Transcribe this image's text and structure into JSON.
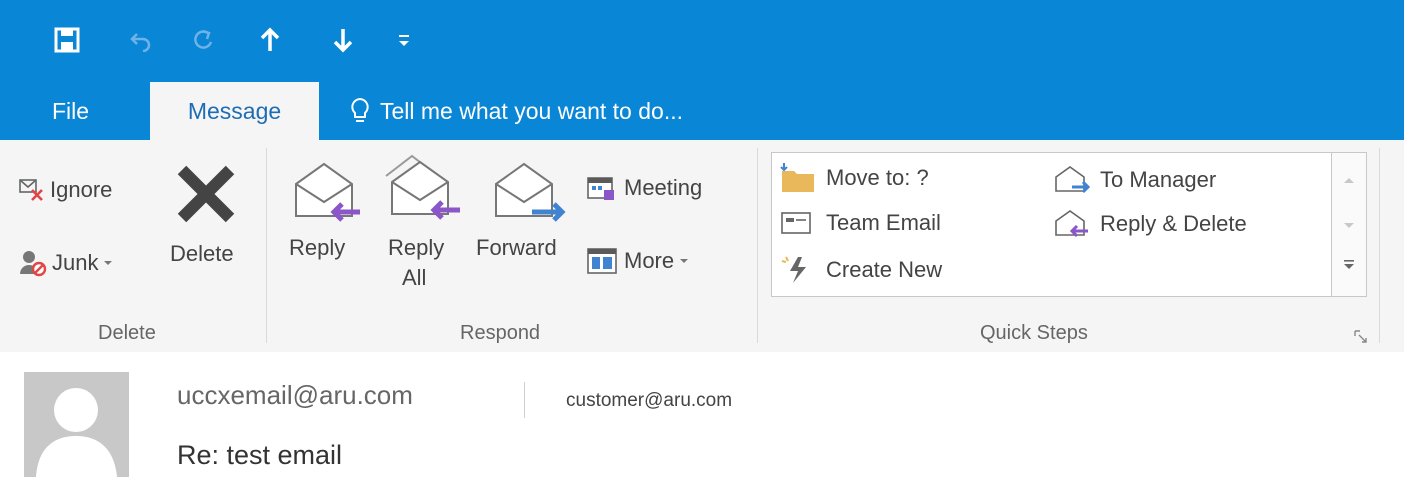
{
  "quick_access": {
    "icons": [
      "save-icon",
      "undo-icon",
      "redo-icon",
      "up-arrow-icon",
      "down-arrow-icon",
      "customize-qat-icon"
    ]
  },
  "tabs": {
    "file": "File",
    "message": "Message",
    "tell_me": "Tell me what you want to do..."
  },
  "ribbon": {
    "delete_group": {
      "ignore": "Ignore",
      "junk": "Junk",
      "delete": "Delete",
      "label": "Delete"
    },
    "respond_group": {
      "reply": "Reply",
      "reply_all_line1": "Reply",
      "reply_all_line2": "All",
      "forward": "Forward",
      "meeting": "Meeting",
      "more": "More",
      "label": "Respond"
    },
    "quick_steps": {
      "items": [
        "Move to: ?",
        "Team Email",
        "Create New",
        "To Manager",
        "Reply & Delete"
      ],
      "label": "Quick Steps"
    }
  },
  "message": {
    "from": "uccxemail@aru.com",
    "to": "customer@aru.com",
    "subject": "Re: test email"
  },
  "colors": {
    "ribbon_blue": "#0a86d6",
    "accent_purple": "#8a56c8",
    "accent_blue": "#3f83d1"
  }
}
